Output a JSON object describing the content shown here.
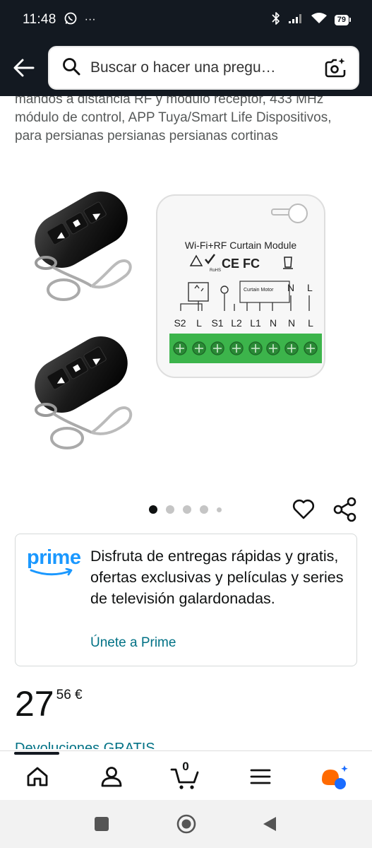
{
  "status": {
    "time": "11:48",
    "more": "···",
    "battery": "79"
  },
  "header": {
    "search_placeholder": "Buscar o hacer una pregu…"
  },
  "product": {
    "title": "mandos a distancia RF y módulo receptor, 433 MHz módulo de control, APP Tuya/Smart Life Dispositivos, para persianas persianas persianas cortinas",
    "image": {
      "module_title": "Wi-Fi+RF Curtain Module",
      "rohs": "RoHS",
      "ce_fc": "CE FC",
      "curtain_motor": "Curtain Motor",
      "top_n": "N",
      "top_l": "L",
      "terminals": [
        "S2",
        "L",
        "S1",
        "L2",
        "L1",
        "N",
        "N",
        "L"
      ]
    },
    "image_count": 5,
    "active_image": 1
  },
  "prime": {
    "logo": "prime",
    "text": "Disfruta de entregas rápidas y gratis, ofertas exclusivas y películas y series de televisión galardonadas.",
    "link": "Únete a Prime"
  },
  "price": {
    "whole": "27",
    "fraction": "56 €"
  },
  "returns": "Devoluciones GRATIS",
  "cart": {
    "count": "0"
  },
  "colors": {
    "header_bg": "#131921",
    "link": "#007185",
    "prime_blue": "#1a98ff",
    "terminal_green": "#3cb44b"
  }
}
